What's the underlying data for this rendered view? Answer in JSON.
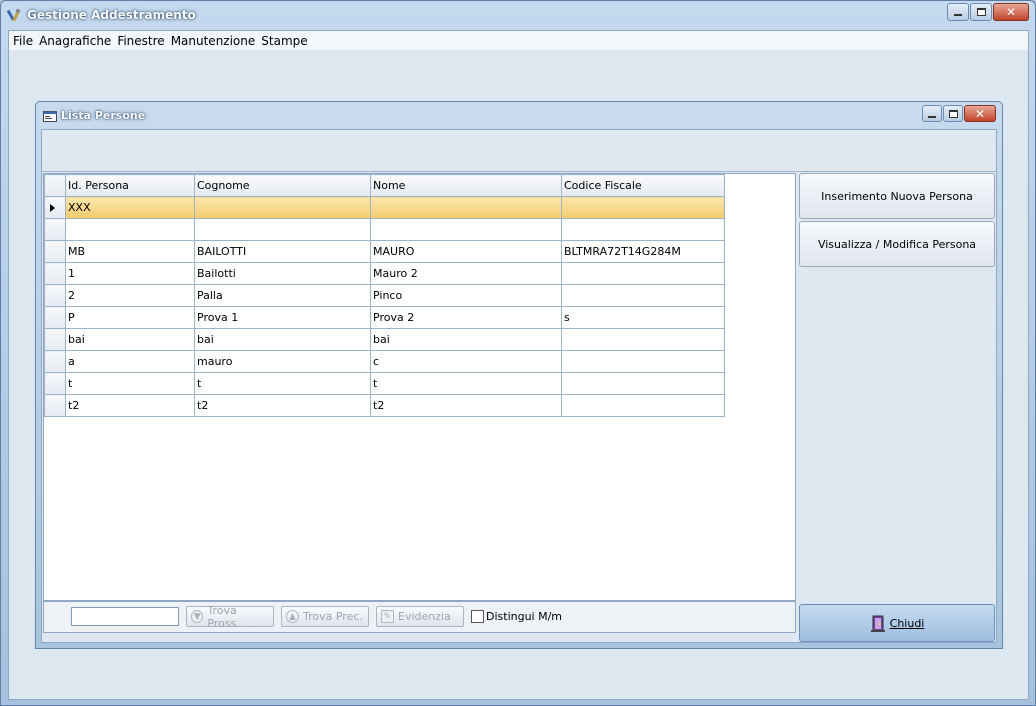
{
  "app": {
    "title": "Gestione Addestramento",
    "menu": [
      "File",
      "Anagrafiche",
      "Finestre",
      "Manutenzione",
      "Stampe"
    ]
  },
  "child": {
    "title": "Lista Persone",
    "columns": [
      "Id. Persona",
      "Cognome",
      "Nome",
      "Codice Fiscale"
    ],
    "rows": [
      [
        "XXX",
        "",
        "",
        ""
      ],
      [
        "",
        "",
        "",
        ""
      ],
      [
        "MB",
        "BAILOTTI",
        "MAURO",
        "BLTMRA72T14G284M"
      ],
      [
        "1",
        "Bailotti",
        "Mauro 2",
        ""
      ],
      [
        "2",
        "Palla",
        "Pinco",
        ""
      ],
      [
        "P",
        "Prova 1",
        "Prova 2",
        "s"
      ],
      [
        "bai",
        "bai",
        "bai",
        ""
      ],
      [
        "a",
        "mauro",
        "c",
        ""
      ],
      [
        "t",
        "t",
        "t",
        ""
      ],
      [
        "t2",
        "t2",
        "t2",
        ""
      ]
    ],
    "selected_row": 0,
    "search": {
      "value": "",
      "find_next_label": "Trova Pross.",
      "find_prev_label": "Trova Prec.",
      "highlight_label": "Evidenzia",
      "case_label": "Distingui M/m"
    },
    "buttons": {
      "new_person": "Inserimento Nuova Persona",
      "view_edit": "Visualizza / Modifica Persona",
      "close": "Chiudi"
    }
  },
  "colors": {
    "selected_row": "#f4cb6b",
    "title_gradient_top": "#c4d9ee",
    "close_button": "#c2442b"
  }
}
